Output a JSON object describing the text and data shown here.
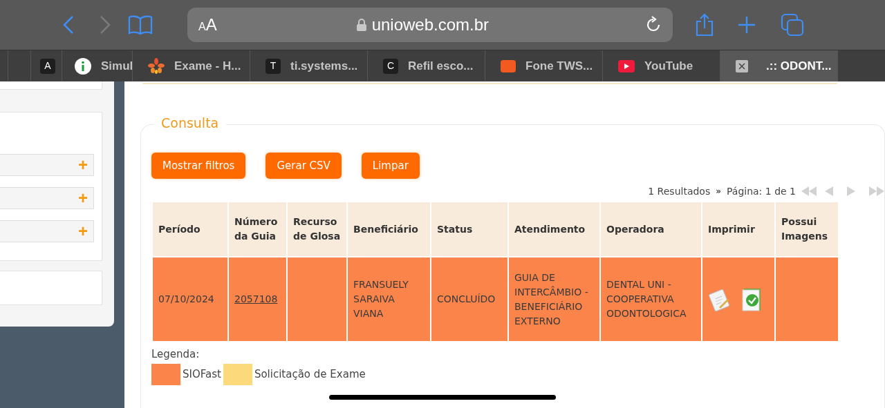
{
  "browser": {
    "text_size_button": "AA",
    "address": "unioweb.com.br"
  },
  "tabs": [
    {
      "kind": "letter",
      "letter": "A",
      "selected": false
    },
    {
      "kind": "info",
      "label": "Simul",
      "selected": false
    },
    {
      "kind": "flower",
      "label": "Exame - H...",
      "selected": false
    },
    {
      "kind": "letter",
      "letter": "T",
      "label": "ti.systems...",
      "selected": false
    },
    {
      "kind": "letter",
      "letter": "C",
      "label": "Refil esco...",
      "selected": false
    },
    {
      "kind": "brand",
      "label": "Fone TWS...",
      "selected": false
    },
    {
      "kind": "play",
      "label": "YouTube",
      "selected": false
    },
    {
      "kind": "close",
      "label": ".:: ODONT...",
      "selected": true
    }
  ],
  "sidebar": {
    "rows": [
      {
        "toggle": "+"
      },
      {
        "toggle": "+"
      },
      {
        "toggle": "+"
      }
    ]
  },
  "consulta": {
    "title": "Consulta",
    "buttons": [
      "Mostrar filtros",
      "Gerar CSV",
      "Limpar"
    ],
    "results": "1 Resultados",
    "separator": "»",
    "page": "Página: 1 de 1",
    "table": {
      "columns": [
        "Período",
        "Número da Guia",
        "Recurso de Glosa",
        "Beneficiário",
        "Status",
        "Atendimento",
        "Operadora",
        "Imprimir",
        "Possui Imagens"
      ],
      "rows": [
        {
          "color": "#fb844a",
          "periodo": "07/10/2024",
          "numero_guia": "2057108",
          "beneficiario": "FRANSUELY SARAIVA VIANA",
          "status": "CONCLUÍDO",
          "atendimento": "GUIA DE INTERCÂMBIO - BENEFICIÁRIO EXTERNO",
          "operadora": "DENTAL UNI - COOPERATIVA ODONTOLOGICA"
        }
      ]
    },
    "legend": {
      "title": "Legenda:",
      "items": [
        {
          "label": "SIOFast",
          "color": "#fb844a"
        },
        {
          "label": "Solicitação de Exame",
          "color": "#fcd97a"
        }
      ]
    }
  }
}
